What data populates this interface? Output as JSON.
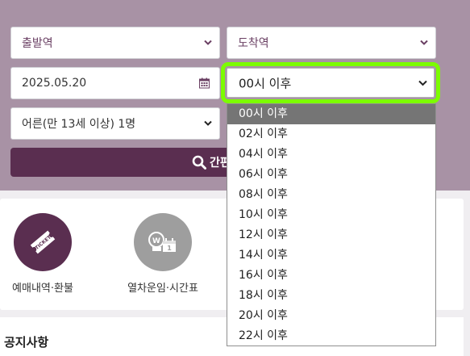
{
  "search": {
    "departure_placeholder": "출발역",
    "arrival_placeholder": "도착역",
    "date_value": "2025.05.20",
    "time_value": "00시 이후",
    "passenger_value": "어른(만 13세 이상) 1명",
    "search_button_label": "간편조"
  },
  "time_options": [
    "00시 이후",
    "02시 이후",
    "04시 이후",
    "06시 이후",
    "08시 이후",
    "10시 이후",
    "12시 이후",
    "14시 이후",
    "16시 이후",
    "18시 이후",
    "20시 이후",
    "22시 이후"
  ],
  "selected_time_index": 0,
  "menu": {
    "items": [
      {
        "label": "예매내역·환불",
        "icon": "ticket-icon"
      },
      {
        "label": "열차운임·시간표",
        "icon": "fare-timetable-icon"
      }
    ]
  },
  "notice": {
    "title": "공지사항"
  },
  "colors": {
    "panel_bg": "#a892a5",
    "primary_purple": "#5a2e50",
    "focus_ring": "#7cfc00",
    "selected_option_bg": "#757575",
    "gray_icon_bg": "#9e9e9e"
  }
}
